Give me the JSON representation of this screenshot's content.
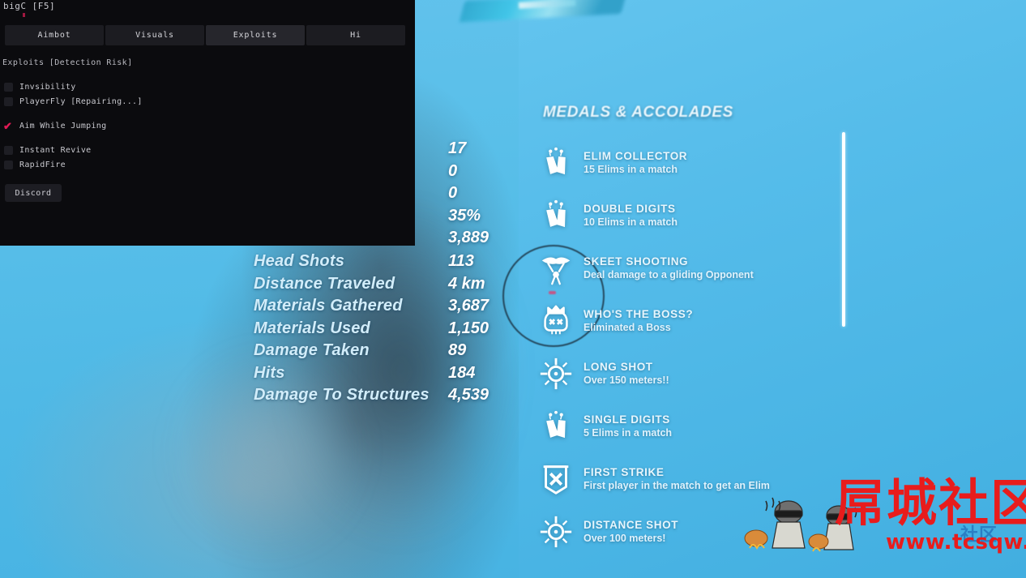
{
  "cheat_menu": {
    "title": "bigC [F5]",
    "tabs": [
      {
        "label": "Aimbot",
        "active": false
      },
      {
        "label": "Visuals",
        "active": false
      },
      {
        "label": "Exploits",
        "active": true
      },
      {
        "label": "Hi",
        "active": false
      }
    ],
    "section_title": "Exploits [Detection Risk]",
    "options": [
      {
        "label": "Invsibility",
        "checked": false,
        "gap": false
      },
      {
        "label": "PlayerFly [Repairing...]",
        "checked": false,
        "gap": false
      },
      {
        "label": "Aim While Jumping",
        "checked": true,
        "gap": true
      },
      {
        "label": "Instant Revive",
        "checked": false,
        "gap": true
      },
      {
        "label": "RapidFire",
        "checked": false,
        "gap": false
      }
    ],
    "check_glyph": "✔",
    "discord_button": "Discord",
    "accent_color": "#e11a55",
    "panel_color": "#0b0b0e"
  },
  "hud": {
    "stats_hidden_values": [
      "17",
      "0",
      "0",
      "35%",
      "3,889"
    ],
    "stats": [
      {
        "label": "Head Shots",
        "value": "113"
      },
      {
        "label": "Distance Traveled",
        "value": "4 km"
      },
      {
        "label": "Materials Gathered",
        "value": "3,687"
      },
      {
        "label": "Materials Used",
        "value": "1,150"
      },
      {
        "label": "Damage Taken",
        "value": "89"
      },
      {
        "label": "Hits",
        "value": "184"
      },
      {
        "label": "Damage To Structures",
        "value": "4,539"
      }
    ],
    "medals": {
      "title": "MEDALS & ACCOLADES",
      "items": [
        {
          "name": "ELIM COLLECTOR",
          "desc": "15 Elims in a match",
          "icon": "dogtags-icon"
        },
        {
          "name": "DOUBLE DIGITS",
          "desc": "10 Elims in a match",
          "icon": "dogtags-icon"
        },
        {
          "name": "SKEET SHOOTING",
          "desc": "Deal damage to a gliding Opponent",
          "icon": "glider-icon"
        },
        {
          "name": "WHO'S THE BOSS?",
          "desc": "Eliminated a Boss",
          "icon": "skull-crown-icon"
        },
        {
          "name": "LONG SHOT",
          "desc": "Over 150 meters!!",
          "icon": "crosshair-icon"
        },
        {
          "name": "SINGLE DIGITS",
          "desc": "5 Elims in a match",
          "icon": "dogtags-icon"
        },
        {
          "name": "FIRST STRIKE",
          "desc": "First player in the match to get an Elim",
          "icon": "banner-x-icon"
        },
        {
          "name": "DISTANCE SHOT",
          "desc": "Over 100 meters!",
          "icon": "crosshair-icon"
        }
      ]
    }
  },
  "watermark": {
    "cn_text": "屌城社区",
    "cn_text_small": "社区",
    "url": "www.tcsqw.com",
    "color": "#e81c1c"
  }
}
